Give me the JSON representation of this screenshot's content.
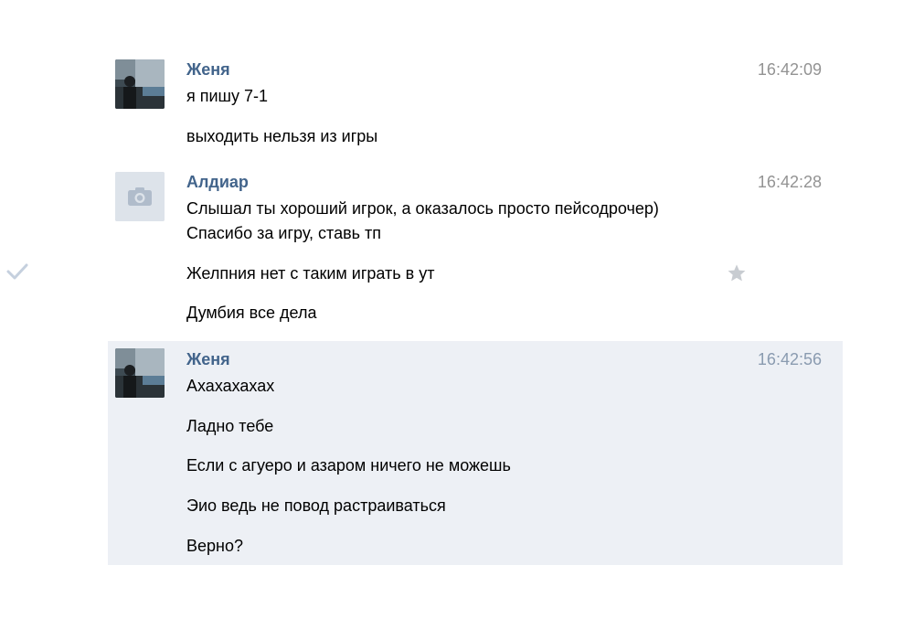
{
  "messages": [
    {
      "sender": "Женя",
      "time": "16:42:09",
      "avatar_icon": "user-photo-icon",
      "lines": [
        "я пишу 7-1",
        "выходить нельзя из игры"
      ]
    },
    {
      "sender": "Алдиар",
      "time": "16:42:28",
      "avatar_icon": "camera-placeholder-icon",
      "lines": [
        "Слышал ты хороший игрок, а оказалось просто пейсодрочер)",
        "Спасибо за игру, ставь тп",
        "Желпния нет с таким играть в ут",
        "Думбия все дела"
      ]
    },
    {
      "sender": "Женя",
      "time": "16:42:56",
      "avatar_icon": "user-photo-icon",
      "lines": [
        "Ахахахахах",
        "Ладно тебе",
        "Если с агуеро и азаром ничего не можешь",
        "Эио ведь не повод растраиваться",
        "Верно?"
      ]
    }
  ],
  "colors": {
    "sender_name": "#42648b",
    "timestamp": "#939393",
    "highlight_background": "#edf0f5",
    "icon_gray": "#c5ccd6"
  }
}
